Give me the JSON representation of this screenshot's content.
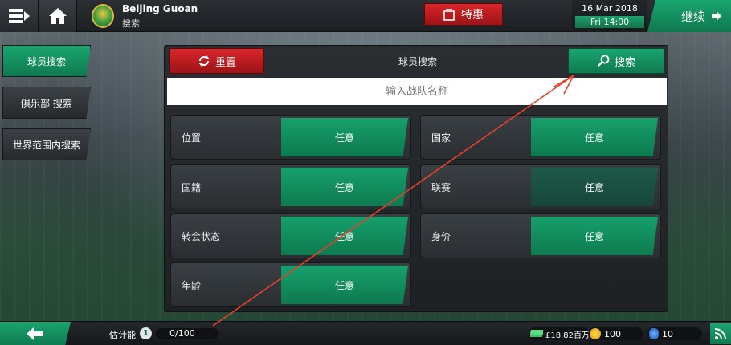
{
  "topbar": {
    "club_name": "Beijing Guoan",
    "club_subtitle": "搜索",
    "offer_label": "特惠",
    "date": "16 Mar 2018",
    "time": "Fri 14:00",
    "continue_label": "继续"
  },
  "sidebar": {
    "items": [
      {
        "label": "球员搜索",
        "active": true
      },
      {
        "label": "俱乐部 搜索",
        "active": false
      },
      {
        "label": "世界范围内搜索",
        "active": false
      }
    ]
  },
  "panel": {
    "reset_label": "重置",
    "title": "球员搜索",
    "search_label": "搜索",
    "team_input_placeholder": "输入战队名称",
    "filters": [
      {
        "label": "位置",
        "value": "任意"
      },
      {
        "label": "国家",
        "value": "任意"
      },
      {
        "label": "国籍",
        "value": "任意"
      },
      {
        "label": "联赛",
        "value": "任意",
        "dim": true
      },
      {
        "label": "转会状态",
        "value": "任意"
      },
      {
        "label": "身价",
        "value": "任意"
      },
      {
        "label": "年龄",
        "value": "任意"
      }
    ]
  },
  "bottombar": {
    "ability_label": "估计能",
    "ability_badge": "1",
    "ability_value": "0/100",
    "money": "£18.82百万",
    "coins": "100",
    "gems": "10"
  },
  "colors": {
    "accent_green": "#15a06b",
    "accent_red": "#d9262a",
    "annotation_arrow": "#e8402a"
  }
}
